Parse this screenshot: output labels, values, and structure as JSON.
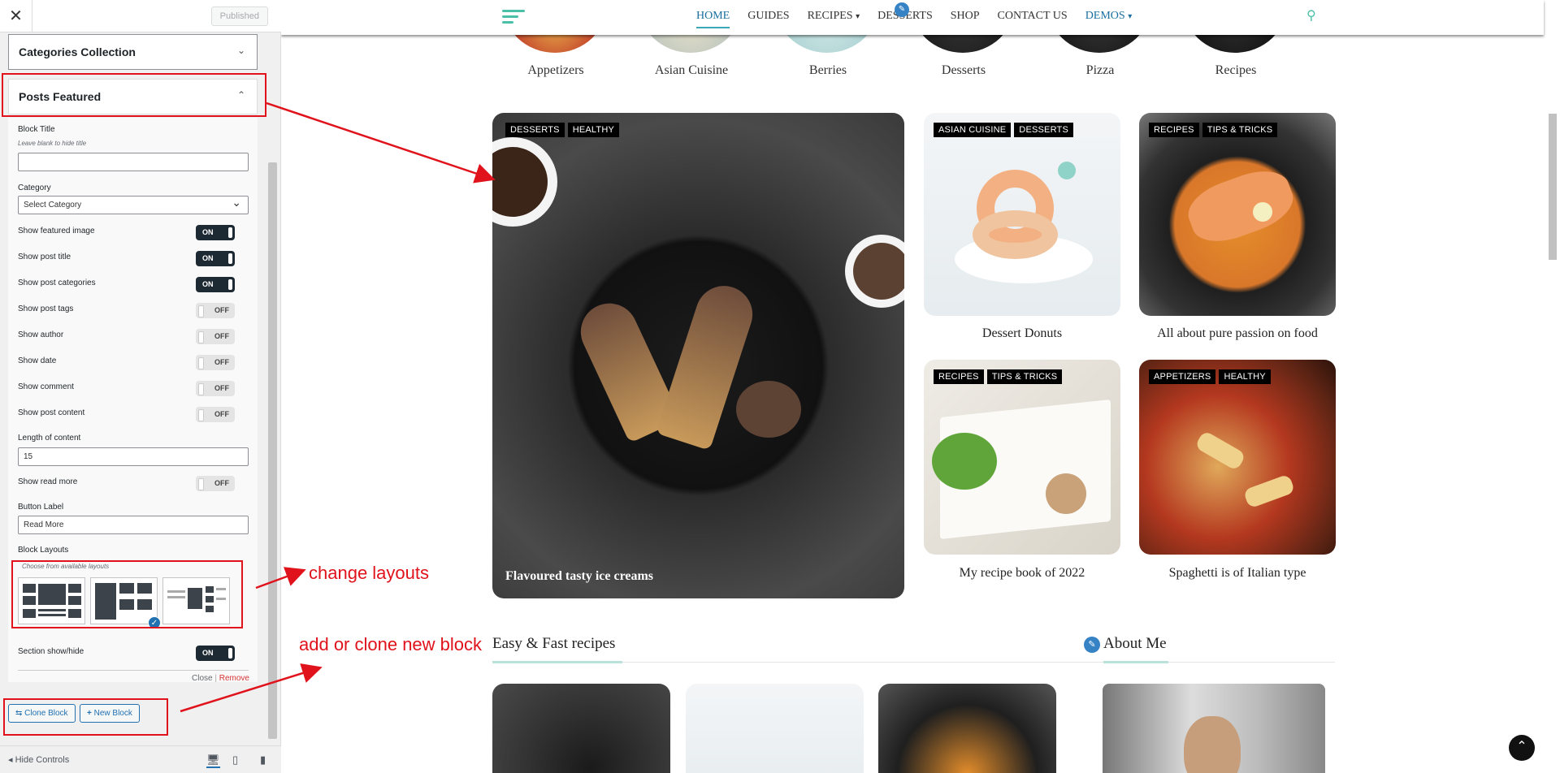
{
  "customizer": {
    "published_label": "Published",
    "sections": {
      "collapsed_title": "Categories Collection",
      "expanded_title": "Posts Featured"
    },
    "fields": {
      "block_title_label": "Block Title",
      "block_title_hint": "Leave blank to hide title",
      "block_title_value": "",
      "category_label": "Category",
      "category_value": "Select Category",
      "toggles": [
        {
          "label": "Show featured image",
          "state": "ON"
        },
        {
          "label": "Show post title",
          "state": "ON"
        },
        {
          "label": "Show post categories",
          "state": "ON"
        },
        {
          "label": "Show post tags",
          "state": "OFF"
        },
        {
          "label": "Show author",
          "state": "OFF"
        },
        {
          "label": "Show date",
          "state": "OFF"
        },
        {
          "label": "Show comment",
          "state": "OFF"
        },
        {
          "label": "Show post content",
          "state": "OFF"
        }
      ],
      "length_label": "Length of content",
      "length_value": "15",
      "read_more_label": "Show read more",
      "read_more_state": "OFF",
      "button_label_label": "Button Label",
      "button_label_value": "Read More",
      "block_layouts_label": "Block Layouts",
      "block_layouts_hint": "Choose from available layouts",
      "section_toggle_label": "Section show/hide",
      "section_toggle_state": "ON"
    },
    "close_label": "Close",
    "remove_label": "Remove",
    "clone_label": "Clone Block",
    "new_label": "New Block",
    "hide_controls_label": "Hide Controls"
  },
  "nav": {
    "items": [
      "HOME",
      "GUIDES",
      "RECIPES",
      "DESSERTS",
      "SHOP",
      "CONTACT US",
      "DEMOS"
    ]
  },
  "categories": [
    "Appetizers",
    "Asian Cuisine",
    "Berries",
    "Desserts",
    "Pizza",
    "Recipes"
  ],
  "featured": {
    "big": {
      "tags": [
        "DESSERTS",
        "HEALTHY"
      ],
      "title": "Flavoured tasty ice creams"
    },
    "cards": [
      {
        "tags": [
          "ASIAN CUISINE",
          "DESSERTS"
        ],
        "title": "Dessert Donuts"
      },
      {
        "tags": [
          "RECIPES",
          "TIPS & TRICKS"
        ],
        "title": "All about pure passion on food"
      },
      {
        "tags": [
          "RECIPES",
          "TIPS & TRICKS"
        ],
        "title": "My recipe book of 2022"
      },
      {
        "tags": [
          "APPETIZERS",
          "HEALTHY"
        ],
        "title": "Spaghetti is of Italian type"
      }
    ]
  },
  "sections": {
    "recipes_title": "Easy & Fast recipes",
    "about_title": "About Me"
  },
  "annotations": {
    "change_layouts": "change layouts",
    "add_clone": "add or clone new block"
  },
  "colors": {
    "accent": "#4bc0a8",
    "link": "#1a6fa0",
    "annotation": "#e0121b"
  }
}
